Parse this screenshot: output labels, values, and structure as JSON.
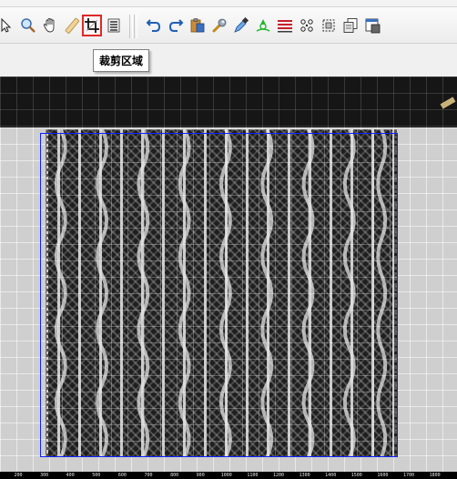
{
  "toolbar": {
    "tools": [
      {
        "id": "select",
        "icon": "cursor-arrow-icon",
        "active": false
      },
      {
        "id": "zoom",
        "icon": "magnifier-icon",
        "active": false
      },
      {
        "id": "pan",
        "icon": "hand-icon",
        "active": false
      },
      {
        "id": "measure",
        "icon": "ruler-icon",
        "active": false
      },
      {
        "id": "crop",
        "icon": "crop-icon",
        "active": true
      },
      {
        "id": "layers",
        "icon": "list-lines-icon",
        "active": false
      },
      {
        "id": "undo",
        "icon": "undo-icon",
        "active": false
      },
      {
        "id": "redo",
        "icon": "redo-icon",
        "active": false
      },
      {
        "id": "paste",
        "icon": "clipboard-icon",
        "active": false
      },
      {
        "id": "repair",
        "icon": "wrench-icon",
        "active": false
      },
      {
        "id": "eyedropper",
        "icon": "eyedropper-icon",
        "active": false
      },
      {
        "id": "flood",
        "icon": "green-fill-icon",
        "active": false
      },
      {
        "id": "stripes",
        "icon": "red-lines-icon",
        "active": false
      },
      {
        "id": "pattern",
        "icon": "dot-grid-icon",
        "active": false
      },
      {
        "id": "select-region",
        "icon": "dashed-select-icon",
        "active": false
      },
      {
        "id": "copy-pages",
        "icon": "copy-pages-icon",
        "active": false
      },
      {
        "id": "export",
        "icon": "export-window-icon",
        "active": false
      }
    ],
    "accent": "#e02828"
  },
  "tooltip": {
    "text": "裁剪区域"
  },
  "viewport": {
    "crop_frame_color": "#1020ff"
  },
  "ruler": {
    "ticks": [
      "200",
      "300",
      "400",
      "500",
      "600",
      "700",
      "800",
      "900",
      "1000",
      "1100",
      "1200",
      "1300",
      "1400",
      "1500",
      "1600",
      "1700",
      "1800"
    ]
  }
}
